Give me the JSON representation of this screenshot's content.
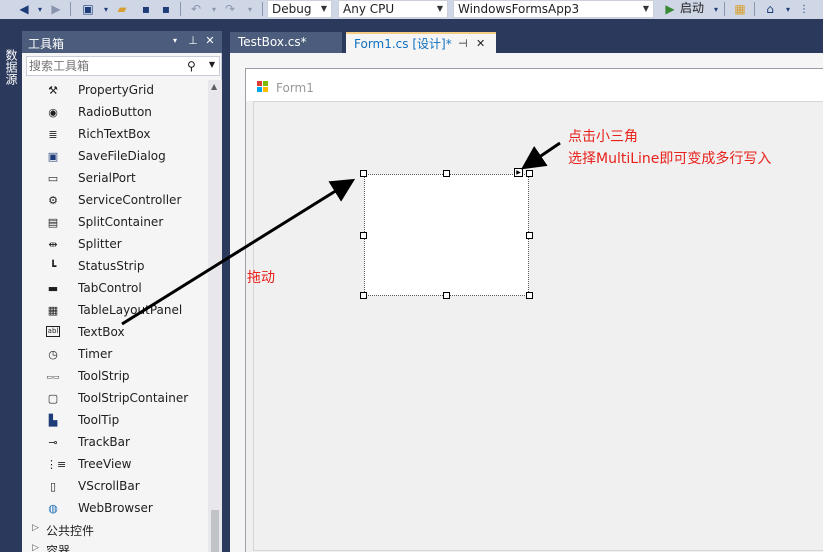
{
  "toolbar": {
    "configuration": "Debug",
    "platform": "Any CPU",
    "project": "WindowsFormsApp3",
    "start_label": "启动",
    "icons": [
      "back-icon",
      "forward-icon",
      "new-project-icon",
      "open-file-icon",
      "save-icon",
      "save-all-icon",
      "undo-icon",
      "redo-icon",
      "start-icon",
      "find-icon",
      "home-icon",
      "overflow-icon"
    ]
  },
  "side_tab": {
    "label": "数据源"
  },
  "toolbox": {
    "title": "工具箱",
    "search_placeholder": "搜索工具箱",
    "items": [
      {
        "label": "PropertyGrid",
        "icon": "property-grid-icon"
      },
      {
        "label": "RadioButton",
        "icon": "radio-button-icon"
      },
      {
        "label": "RichTextBox",
        "icon": "rich-textbox-icon"
      },
      {
        "label": "SaveFileDialog",
        "icon": "save-file-dialog-icon"
      },
      {
        "label": "SerialPort",
        "icon": "serial-port-icon"
      },
      {
        "label": "ServiceController",
        "icon": "service-controller-icon"
      },
      {
        "label": "SplitContainer",
        "icon": "split-container-icon"
      },
      {
        "label": "Splitter",
        "icon": "splitter-icon"
      },
      {
        "label": "StatusStrip",
        "icon": "status-strip-icon"
      },
      {
        "label": "TabControl",
        "icon": "tab-control-icon"
      },
      {
        "label": "TableLayoutPanel",
        "icon": "table-layout-panel-icon"
      },
      {
        "label": "TextBox",
        "icon": "textbox-icon"
      },
      {
        "label": "Timer",
        "icon": "timer-icon"
      },
      {
        "label": "ToolStrip",
        "icon": "toolstrip-icon"
      },
      {
        "label": "ToolStripContainer",
        "icon": "toolstrip-container-icon"
      },
      {
        "label": "ToolTip",
        "icon": "tooltip-icon"
      },
      {
        "label": "TrackBar",
        "icon": "trackbar-icon"
      },
      {
        "label": "TreeView",
        "icon": "treeview-icon"
      },
      {
        "label": "VScrollBar",
        "icon": "vscrollbar-icon"
      },
      {
        "label": "WebBrowser",
        "icon": "web-browser-icon"
      }
    ],
    "groups": [
      {
        "label": "公共控件"
      },
      {
        "label": "容器"
      }
    ]
  },
  "tabs": [
    {
      "label": "TestBox.cs*",
      "active": false
    },
    {
      "label": "Form1.cs [设计]*",
      "active": true
    }
  ],
  "form": {
    "title": "Form1"
  },
  "annotations": {
    "drag": "拖动",
    "tip_line1": "点击小三角",
    "tip_line2": "选择MultiLine即可变成多行写入",
    "color": "#e8211b"
  },
  "colors": {
    "chrome": "#2b3a5c",
    "toolbar": "#cfd6e5",
    "active_tab_text": "#0e70c0"
  }
}
